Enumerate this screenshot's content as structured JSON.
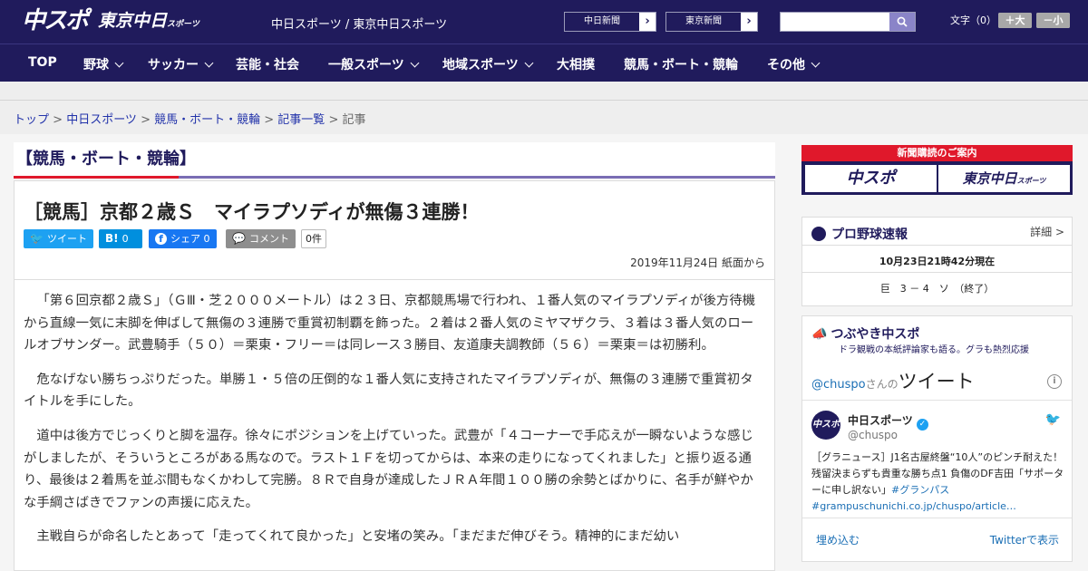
{
  "header": {
    "logo_main": "中スポ",
    "logo_tokyo": "東京中日",
    "logo_tokyo_small": "スポーツ",
    "site_title": "中日スポーツ / 東京中日スポーツ",
    "paper_buttons": [
      "中日新聞",
      "東京新聞"
    ],
    "search_placeholder": "",
    "font_size": {
      "label": "文字（0）",
      "larger": "＋大",
      "smaller": "－小"
    }
  },
  "nav": [
    {
      "label": "TOP",
      "dropdown": false
    },
    {
      "label": "野球",
      "dropdown": true
    },
    {
      "label": "サッカー",
      "dropdown": true
    },
    {
      "label": "芸能・社会",
      "dropdown": false
    },
    {
      "label": "一般スポーツ",
      "dropdown": true
    },
    {
      "label": "地域スポーツ",
      "dropdown": true
    },
    {
      "label": "大相撲",
      "dropdown": false
    },
    {
      "label": "競馬・ボート・競輪",
      "dropdown": false
    },
    {
      "label": "その他",
      "dropdown": true
    }
  ],
  "breadcrumb": [
    "トップ",
    "中日スポーツ",
    "競馬・ボート・競輪",
    "記事一覧",
    "記事"
  ],
  "section_title": "【競馬・ボート・競輪】",
  "article": {
    "headline": "［競馬］京都２歳Ｓ　マイラプソディが無傷３連勝！",
    "share": {
      "tweet": "ツイート",
      "hatena": "0",
      "facebook": "シェア 0",
      "comment": "コメント",
      "comment_count": "0件"
    },
    "date": "2019年11月24日 紙面から",
    "paragraphs": [
      "「第６回京都２歳Ｓ」（ＧⅢ・芝２０００メートル）は２３日、京都競馬場で行われ、１番人気のマイラプソディが後方待機から直線一気に末脚を伸ばして無傷の３連勝で重賞初制覇を飾った。２着は２番人気のミヤマザクラ、３着は３番人気のロールオブサンダー。武豊騎手（５０）＝栗東・フリー＝は同レース３勝目、友道康夫調教師（５６）＝栗東＝は初勝利。",
      "危なげない勝ちっぷりだった。単勝１・５倍の圧倒的な１番人気に支持されたマイラプソディが、無傷の３連勝で重賞初タイトルを手にした。",
      "道中は後方でじっくりと脚を温存。徐々にポジションを上げていった。武豊が「４コーナーで手応えが一瞬ないような感じがしましたが、そういうところがある馬なので。ラスト１Ｆを切ってからは、本来の走りになってくれました」と振り返る通り、最後は２着馬を並ぶ間もなくかわして完勝。８Ｒで自身が達成したＪＲＡ年間１００勝の余勢とばかりに、名手が鮮やかな手綱さばきでファンの声援に応えた。",
      "主戦自らが命名したとあって「走ってくれて良かった」と安堵の笑み。「まだまだ伸びそう。精神的にまだ幼い"
    ]
  },
  "sidebar": {
    "ad": {
      "title": "新聞購読のご案内",
      "left": "中スポ",
      "right": "東京中日",
      "right_small": "スポーツ"
    },
    "baseball": {
      "title": "プロ野球速報",
      "detail": "詳細 >",
      "status": "10月23日21時42分現在",
      "score": "巨　3 － 4　ソ　（終了）"
    },
    "tsubuyaki": {
      "title": "つぶやき中スポ",
      "subtitle": "ドラ観戦の本紙評論家も語る。グラも熱烈応援",
      "handle": "@chuspo",
      "handle_suffix": "さんの",
      "tweets_label": "ツイート",
      "account_name": "中日スポーツ",
      "account_handle": "@chuspo",
      "tweet_text": "［グラニュース］J1名古屋終盤“10人”のピンチ耐えた！残留決まらずも貴重な勝ち点1 負傷のDF吉田「サポーターに申し訳ない」",
      "tweet_hashtag": "#グランパス",
      "tweet_link": "#grampuschunichi.co.jp/chuspo/article…",
      "embed": "埋め込む",
      "view_on_twitter": "Twitterで表示"
    }
  },
  "colors": {
    "brand": "#201b5c",
    "accent_red": "#e0182b",
    "twitter": "#1da1f2",
    "hatena": "#008fde",
    "facebook": "#1877f2",
    "comment": "#8e8e8e"
  }
}
